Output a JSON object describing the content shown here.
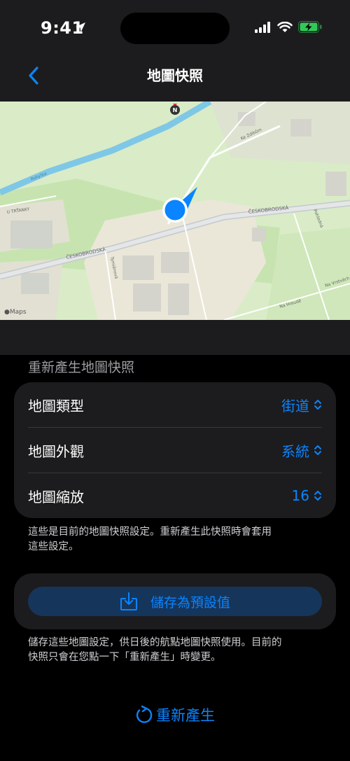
{
  "status_bar": {
    "time": "9:41"
  },
  "nav": {
    "title": "地圖快照"
  },
  "map": {
    "attribution": "Maps",
    "compass": "N",
    "street_labels": [
      "ČESKOBRODSKÁ",
      "ČESKOBRODSKÁ",
      "Rokytka",
      "U TRŤANKY",
      "Na Hroudě",
      "Na Vrstvách",
      "Ke Zdibům",
      "Tymiánová",
      "Pohledná"
    ]
  },
  "section": {
    "header": "重新產生地圖快照"
  },
  "settings": {
    "rows": [
      {
        "label": "地圖類型",
        "value": "街道"
      },
      {
        "label": "地圖外觀",
        "value": "系統"
      },
      {
        "label": "地圖縮放",
        "value": "16"
      }
    ],
    "footnote_lines": [
      "這些是目前的地圖快照設定。重新產生此快照時會套用",
      "這些設定。"
    ]
  },
  "save": {
    "label": "儲存為預設值",
    "footnote_lines": [
      "儲存這些地圖設定，供日後的航點地圖快照使用。目前的",
      "快照只會在您點一下「重新產生」時變更。"
    ]
  },
  "regenerate": {
    "label": "重新產生"
  },
  "colors": {
    "accent": "#0a84ff",
    "background": "#000000",
    "card": "#1c1c1e",
    "save_button_bg": "#16355b"
  }
}
